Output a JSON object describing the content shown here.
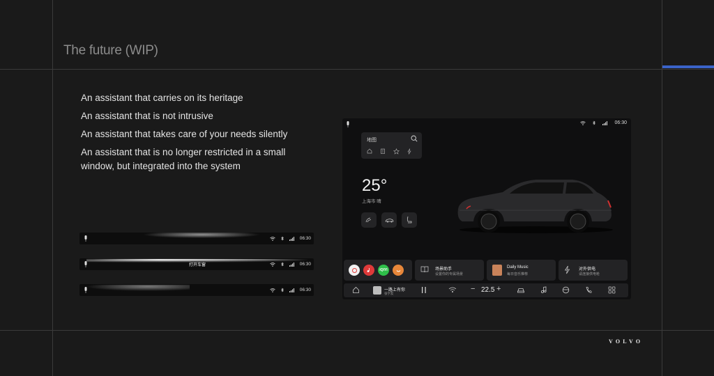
{
  "slide": {
    "title": "The future (WIP)",
    "brand": "VOLVO"
  },
  "colors": {
    "accent": "#3a63c8",
    "background": "#1a1a1a"
  },
  "bullets": [
    "An assistant that carries on its heritage",
    "An assistant that is not intrusive",
    "An assistant that takes care of your needs silently",
    "An assistant that is no longer restricted in a small window, but integrated into the system"
  ],
  "bars": [
    {
      "time": "06:30",
      "command": ""
    },
    {
      "time": "06:30",
      "command": "打开车窗"
    },
    {
      "time": "06:30",
      "command": ""
    }
  ],
  "screen": {
    "time": "06:30",
    "map_label": "地图",
    "temperature": "25°",
    "city": "上海市 晴",
    "apps": [
      {
        "name": "app-1",
        "color": "#f2f2f2"
      },
      {
        "name": "app-2",
        "color": "#e03a3a"
      },
      {
        "name": "app-3",
        "color": "#2fbf4a",
        "label": "iQIYI"
      },
      {
        "name": "app-4",
        "color": "#e8873a"
      }
    ],
    "widgets": [
      {
        "title": "场景助手",
        "subtitle": "设置你的专属场景"
      },
      {
        "title": "Daily Music",
        "subtitle": "每日音乐推荐"
      },
      {
        "title": "对外供电",
        "subtitle": "请连接供电枪"
      }
    ],
    "bottom": {
      "track": "一路上有你",
      "artist": "张学友",
      "temp": "22.5"
    }
  }
}
